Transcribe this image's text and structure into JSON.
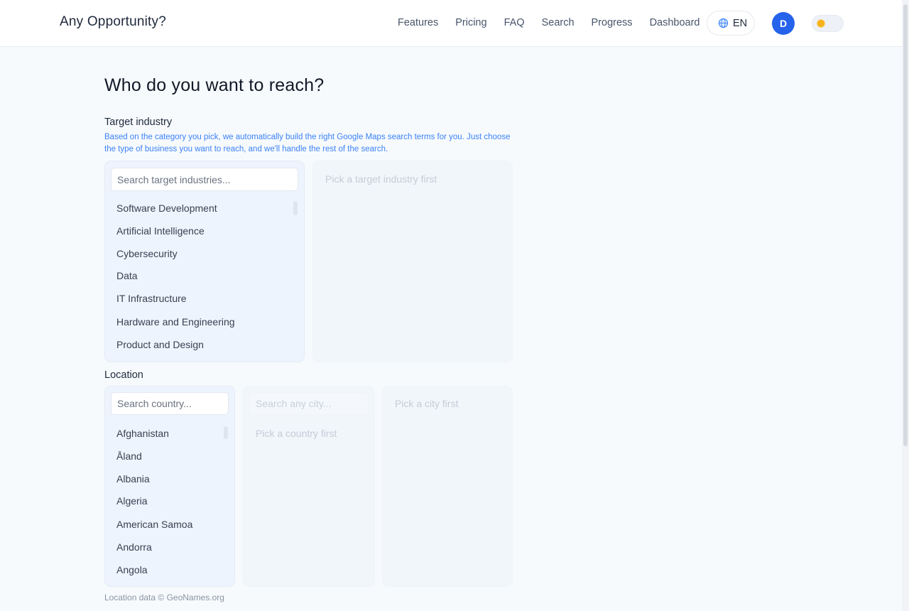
{
  "brand": "Any Opportunity?",
  "nav": [
    "Features",
    "Pricing",
    "FAQ",
    "Search",
    "Progress",
    "Dashboard"
  ],
  "language": "EN",
  "avatar_initial": "D",
  "page_title": "Who do you want to reach?",
  "industry": {
    "label": "Target industry",
    "help": "Based on the category you pick, we automatically build the right Google Maps search terms for you. Just choose the type of business you want to reach, and we'll handle the rest of the search.",
    "search_placeholder": "Search target industries...",
    "items": [
      "Software Development",
      "Artificial Intelligence",
      "Cybersecurity",
      "Data",
      "IT Infrastructure",
      "Hardware and Engineering",
      "Product and Design"
    ],
    "detail_hint": "Pick a target industry first"
  },
  "location": {
    "label": "Location",
    "country_placeholder": "Search country...",
    "countries": [
      "Afghanistan",
      "Åland",
      "Albania",
      "Algeria",
      "American Samoa",
      "Andorra",
      "Angola"
    ],
    "city_placeholder": "Search any city...",
    "city_hint": "Pick a country first",
    "detail_hint": "Pick a city first"
  },
  "footer": "Location data © GeoNames.org",
  "colors": {
    "accent": "#2563eb",
    "help_text": "#3b82f6",
    "toggle_sun": "#f5b21b"
  }
}
